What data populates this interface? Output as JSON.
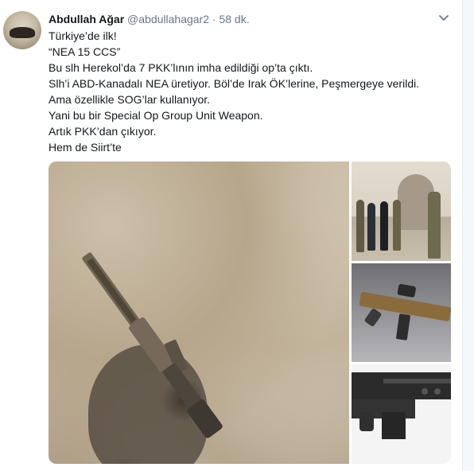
{
  "tweet": {
    "display_name": "Abdullah Ağar",
    "handle": "@abdullahagar2",
    "separator": "·",
    "time": "58 dk.",
    "lines": [
      "Türkiye’de ilk!",
      "“NEA 15 CCS”",
      "Bu slh Herekol’da 7 PKK’lının imha edildiği op’ta çıktı.",
      "Slh’i ABD-Kanadalı NEA üretiyor. Böl’de Irak ÖK’lerine, Peşmergeye verildi.",
      "Ama özellikle SOG’lar kullanıyor.",
      "Yani bu bir Special Op Group Unit Weapon.",
      "Artık PKK’dan çıkıyor.",
      "Hem de Siirt’te"
    ]
  },
  "icons": {
    "avatar": "avatar-image",
    "menu": "chevron-down-icon"
  },
  "colors": {
    "name_text": "#14171a",
    "secondary_text": "#657786"
  }
}
